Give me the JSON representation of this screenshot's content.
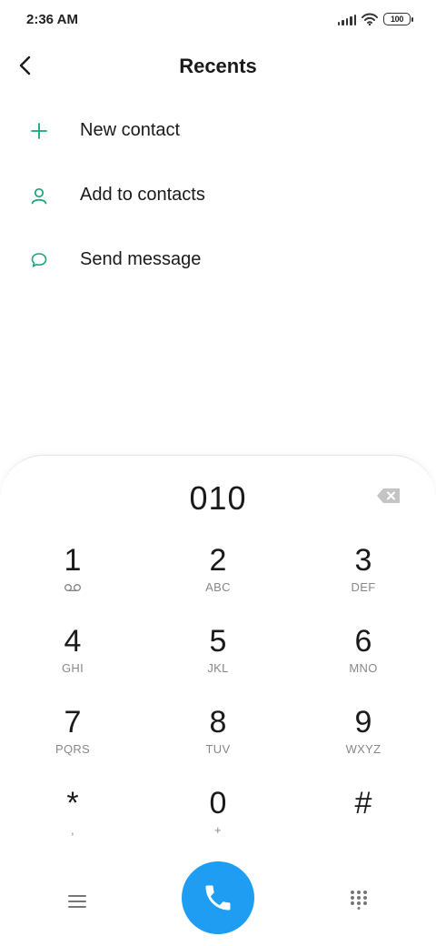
{
  "status_bar": {
    "time": "2:36 AM",
    "battery": "100"
  },
  "header": {
    "title": "Recents",
    "back_icon": "chevron-left-icon"
  },
  "actions": [
    {
      "label": "New contact",
      "icon": "plus-icon"
    },
    {
      "label": "Add to contacts",
      "icon": "person-icon"
    },
    {
      "label": "Send message",
      "icon": "message-icon"
    }
  ],
  "dialer": {
    "number": "010",
    "keys": [
      {
        "digit": "1",
        "letters": ""
      },
      {
        "digit": "2",
        "letters": "ABC"
      },
      {
        "digit": "3",
        "letters": "DEF"
      },
      {
        "digit": "4",
        "letters": "GHI"
      },
      {
        "digit": "5",
        "letters": "JKL"
      },
      {
        "digit": "6",
        "letters": "MNO"
      },
      {
        "digit": "7",
        "letters": "PQRS"
      },
      {
        "digit": "8",
        "letters": "TUV"
      },
      {
        "digit": "9",
        "letters": "WXYZ"
      },
      {
        "digit": "*",
        "letters": ","
      },
      {
        "digit": "0",
        "letters": "+"
      },
      {
        "digit": "#",
        "letters": ""
      }
    ]
  },
  "colors": {
    "accent_green": "#1aa37a",
    "call_blue": "#1e9df2",
    "sub_text": "#888888"
  }
}
